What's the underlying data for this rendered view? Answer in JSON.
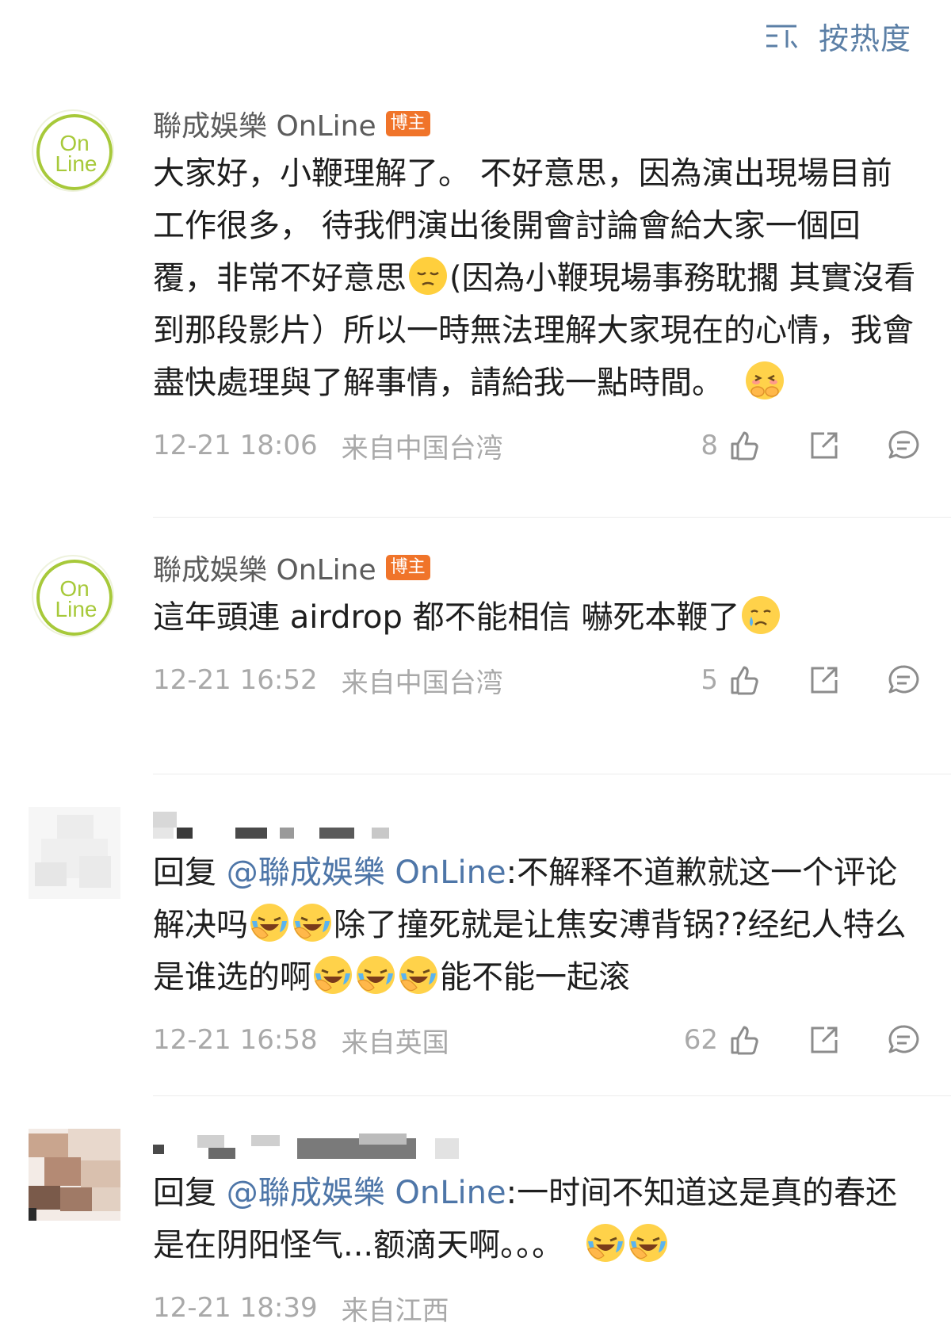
{
  "header": {
    "sort_label": "按热度",
    "sort_icon": "sort-lines-icon"
  },
  "comments": [
    {
      "author": "聯成娛樂 OnLine",
      "badge": "博主",
      "avatar_text": [
        "On",
        "Line"
      ],
      "text_1": "大家好，小鞭理解了。 不好意思，因為演出現場目前工作很多， 待我們演出後開會討論會給大家一個回覆，非常不好意思",
      "text_2": "(因為小鞭現場事務耽擱 其實沒看到那段影片）所以一時無法理解大家現在的心情，我會盡快處理與了解事情，請給我一點時間。",
      "time": "12-21 18:06",
      "location": "来自中国台湾",
      "likes": "8"
    },
    {
      "author": "聯成娛樂 OnLine",
      "badge": "博主",
      "avatar_text": [
        "On",
        "Line"
      ],
      "text_1": "這年頭連 airdrop 都不能相信  嚇死本鞭了",
      "time": "12-21 16:52",
      "location": "来自中国台湾",
      "likes": "5"
    },
    {
      "reply_prefix": "回复",
      "mention": "@聯成娛樂 OnLine",
      "text_1": ":不解释不道歉就这一个评论解决吗",
      "text_2": "除了撞死就是让焦安溥背锅??经纪人特么是谁选的啊",
      "text_3": "能不能一起滚",
      "time": "12-21 16:58",
      "location": "来自英国",
      "likes": "62"
    },
    {
      "reply_prefix": "回复",
      "mention": "@聯成娛樂 OnLine",
      "text_1": ":一时间不知道这是真的春还是在阴阳怪气...额滴天啊。。。",
      "time": "12-21 18:39",
      "location": "来自江西"
    }
  ],
  "icons": {
    "like": "thumbs-up-icon",
    "share": "share-icon",
    "comment": "comment-icon"
  },
  "colors": {
    "mention": "#4e76a8",
    "badge": "#f0742a",
    "logo_green": "#a7c93a",
    "meta_gray": "#a9a9a9"
  }
}
